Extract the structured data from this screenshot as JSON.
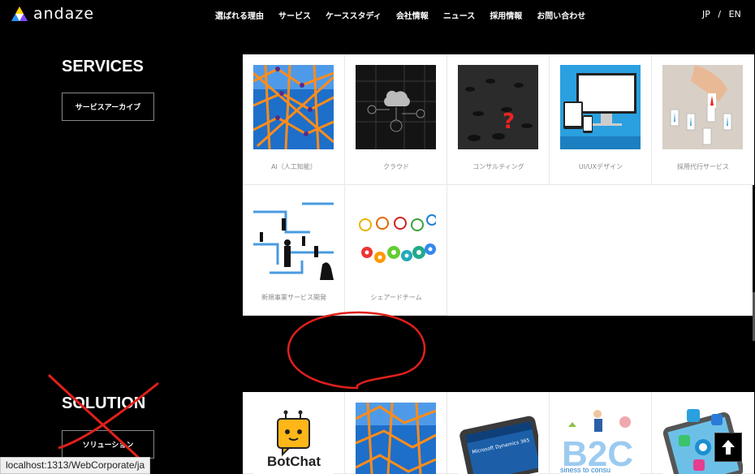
{
  "header": {
    "logo_text": "andaze",
    "nav": [
      "選ばれる理由",
      "サービス",
      "ケーススタディ",
      "会社情報",
      "ニュース",
      "採用情報",
      "お問い合わせ"
    ],
    "lang_jp": "JP",
    "lang_sep": "/",
    "lang_en": "EN"
  },
  "services": {
    "title": "SERVICES",
    "archive_label": "サービスアーカイブ",
    "items": [
      {
        "label": "AI（人工知能）",
        "image": "orange-blue-lattice"
      },
      {
        "label": "クラウド",
        "image": "cloud-network"
      },
      {
        "label": "コンサルティング",
        "image": "red-question-mark"
      },
      {
        "label": "UI/UXデザイン",
        "image": "devices"
      },
      {
        "label": "採用代行サービス",
        "image": "hand-with-figures"
      },
      {
        "label": "新規事業サービス開発",
        "image": "maze-silhouettes"
      },
      {
        "label": "シェアードチーム",
        "image": "colorful-gears"
      }
    ]
  },
  "solution": {
    "title": "SOLUTION",
    "archive_label": "ソリューション",
    "items": [
      {
        "label": "BotChat",
        "image": "botchat-logo"
      },
      {
        "label": "",
        "image": "orange-blue-lattice"
      },
      {
        "label": "",
        "image": "dynamics-phone"
      },
      {
        "label": "",
        "image": "b2c-graphic"
      },
      {
        "label": "",
        "image": "app-icons"
      }
    ],
    "botchat_logo_text": "BotChat",
    "dynamics_text": "Microsoft Dynamics 365",
    "b2c_text": "B2C",
    "b2c_sub": "siness to consu"
  },
  "status_url": "localhost:1313/WebCorporate/ja",
  "icons": {
    "back_to_top": "arrow-up-icon"
  },
  "colors": {
    "background": "#000000",
    "annotation": "#e0201a",
    "card": "#ffffff"
  }
}
